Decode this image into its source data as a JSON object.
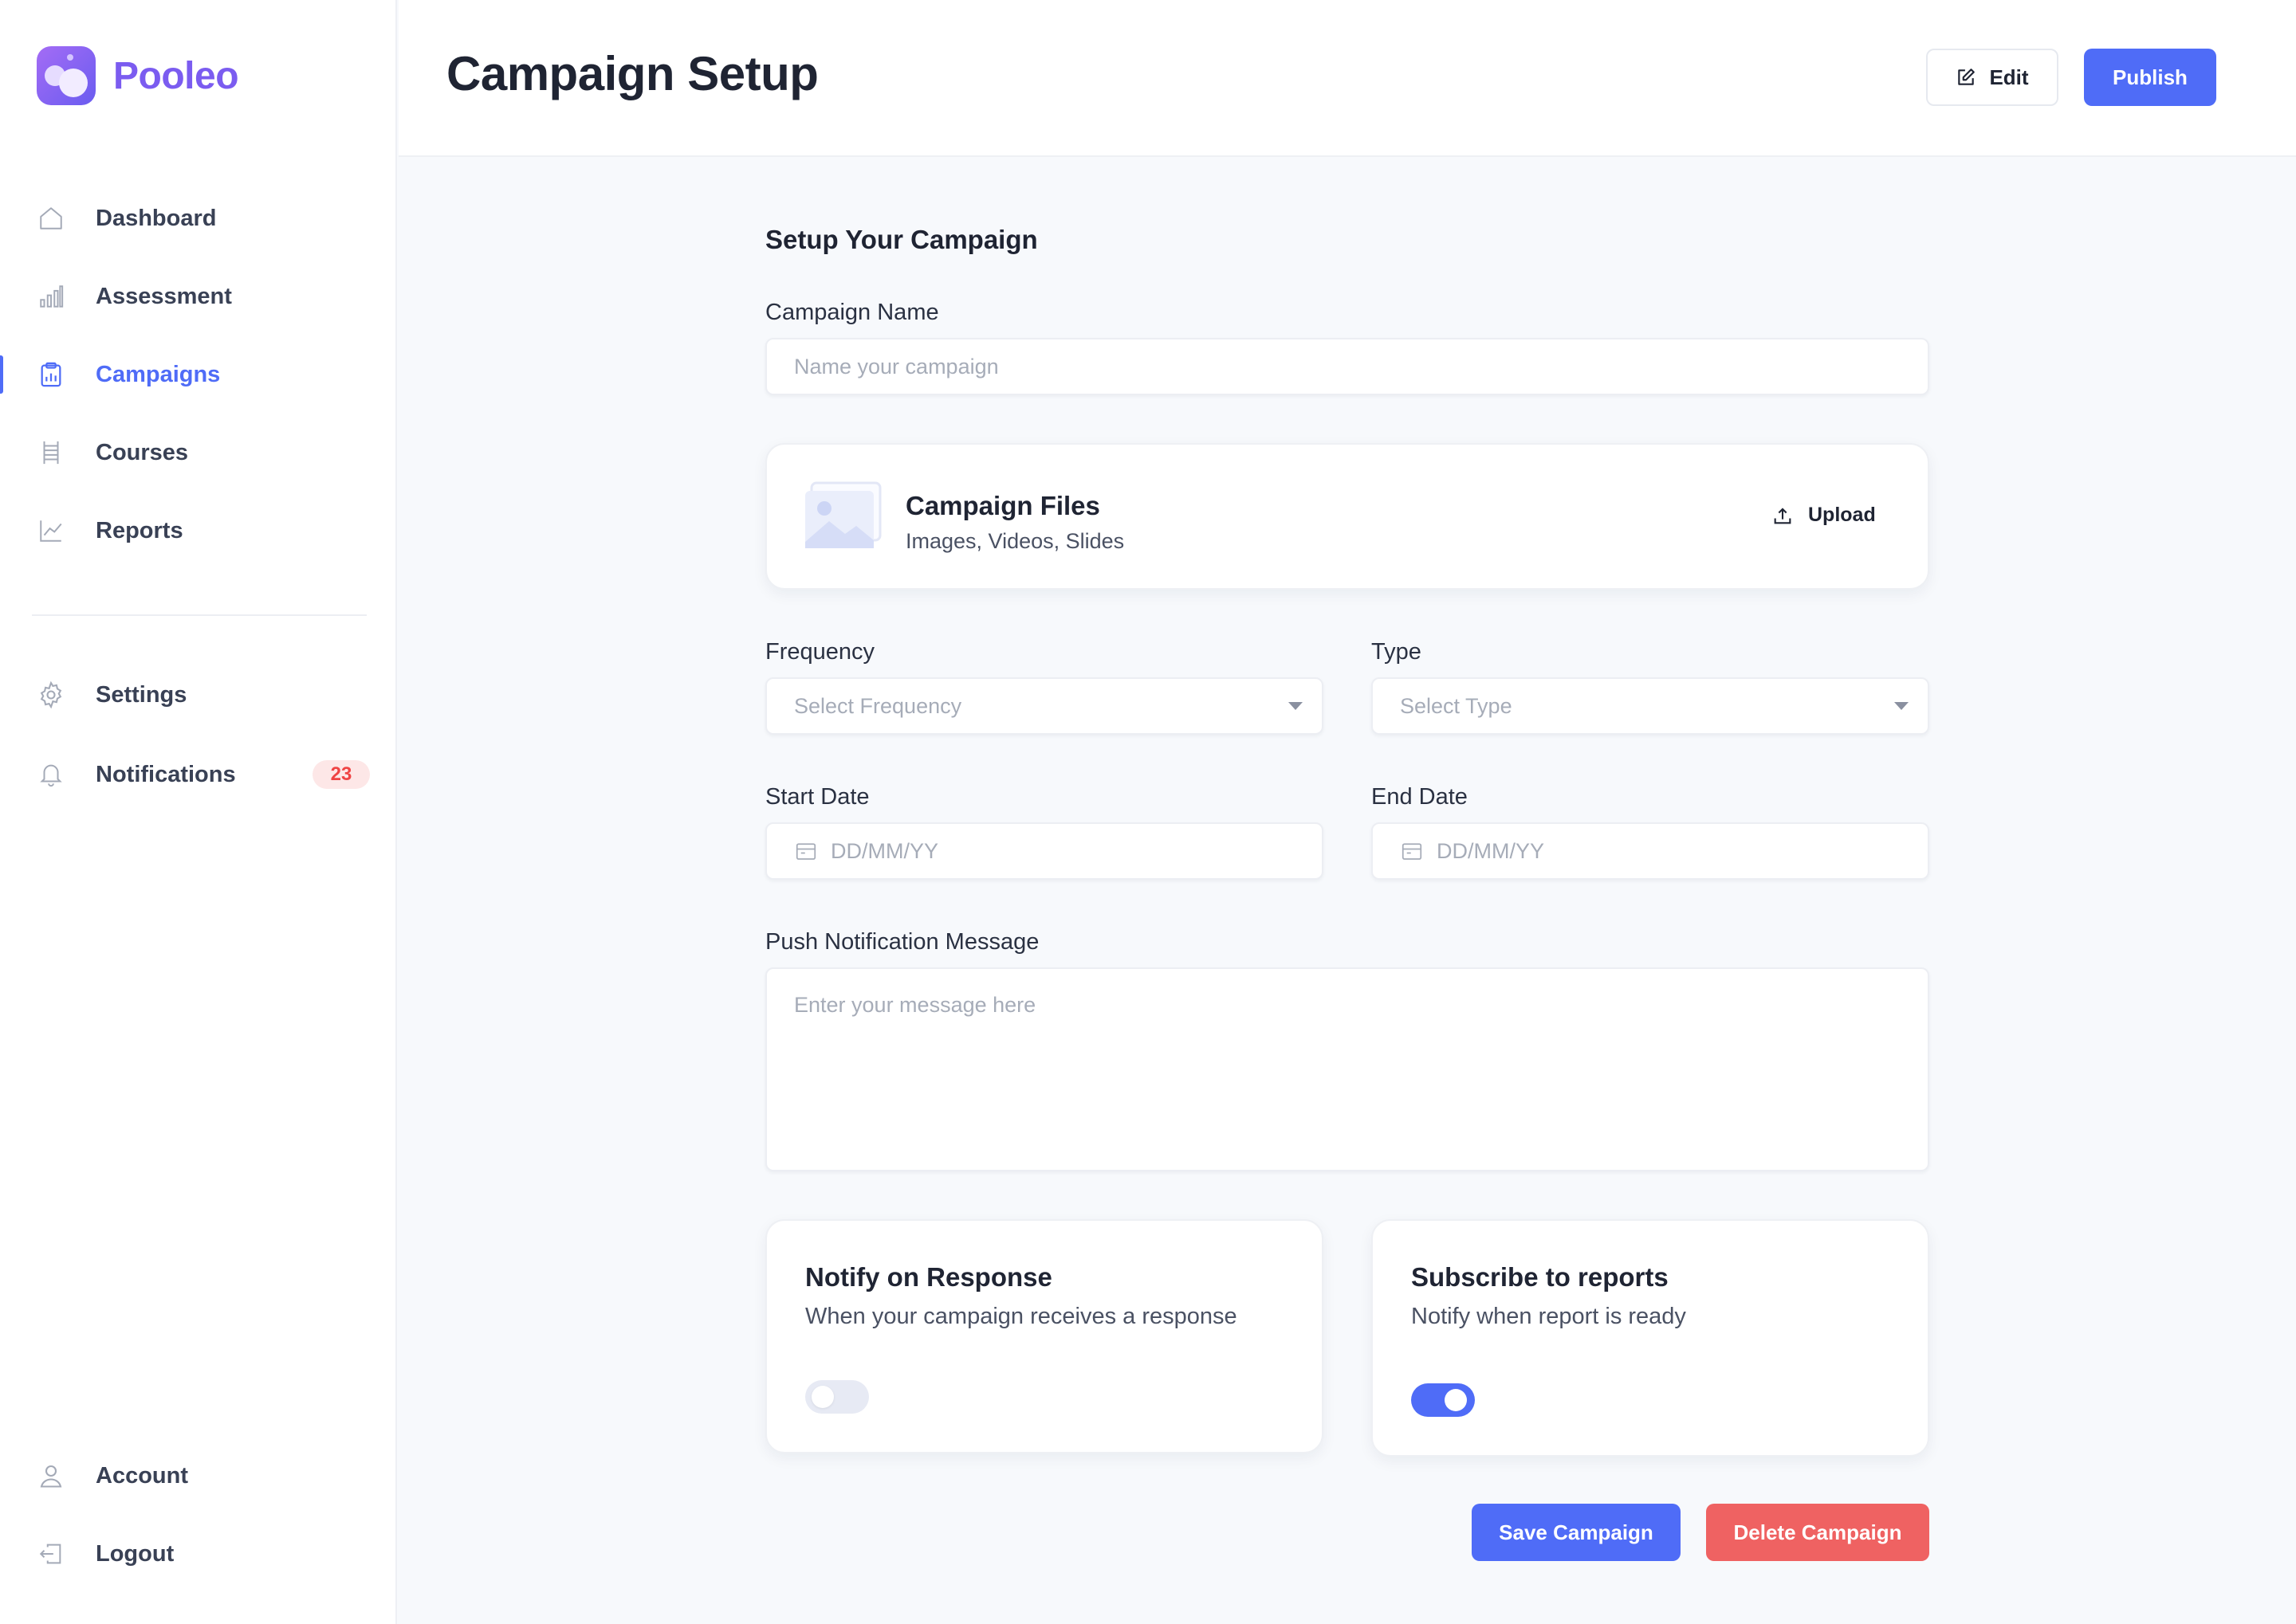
{
  "app": {
    "name": "Pooleo"
  },
  "sidebar": {
    "items": [
      {
        "label": "Dashboard",
        "icon": "home-icon"
      },
      {
        "label": "Assessment",
        "icon": "bar-chart-icon"
      },
      {
        "label": "Campaigns",
        "icon": "clipboard-chart-icon",
        "active": true
      },
      {
        "label": "Courses",
        "icon": "ladder-icon"
      },
      {
        "label": "Reports",
        "icon": "line-chart-icon"
      }
    ],
    "secondary": [
      {
        "label": "Settings",
        "icon": "gear-icon"
      },
      {
        "label": "Notifications",
        "icon": "bell-icon",
        "badge": "23"
      }
    ],
    "bottom": [
      {
        "label": "Account",
        "icon": "user-icon"
      },
      {
        "label": "Logout",
        "icon": "logout-icon"
      }
    ]
  },
  "header": {
    "title": "Campaign Setup",
    "edit_label": "Edit",
    "publish_label": "Publish"
  },
  "form": {
    "heading": "Setup Your Campaign",
    "campaign_name": {
      "label": "Campaign Name",
      "placeholder": "Name your campaign"
    },
    "files": {
      "title": "Campaign Files",
      "subtitle": "Images, Videos, Slides",
      "upload_label": "Upload"
    },
    "frequency": {
      "label": "Frequency",
      "placeholder": "Select Frequency"
    },
    "type": {
      "label": "Type",
      "placeholder": "Select Type"
    },
    "start_date": {
      "label": "Start Date",
      "placeholder": "DD/MM/YY"
    },
    "end_date": {
      "label": "End Date",
      "placeholder": "DD/MM/YY"
    },
    "message": {
      "label": "Push Notification Message",
      "placeholder": "Enter your message here"
    },
    "notify_response": {
      "title": "Notify on Response",
      "subtitle": "When your campaign receives a response",
      "enabled": false
    },
    "subscribe_reports": {
      "title": "Subscribe to reports",
      "subtitle": "Notify when report is ready",
      "enabled": true
    },
    "save_label": "Save Campaign",
    "delete_label": "Delete Campaign"
  },
  "colors": {
    "accent": "#4f6cf7",
    "danger": "#ef6262",
    "brand": "#7b5cf0",
    "badge_text": "#ef4444"
  }
}
